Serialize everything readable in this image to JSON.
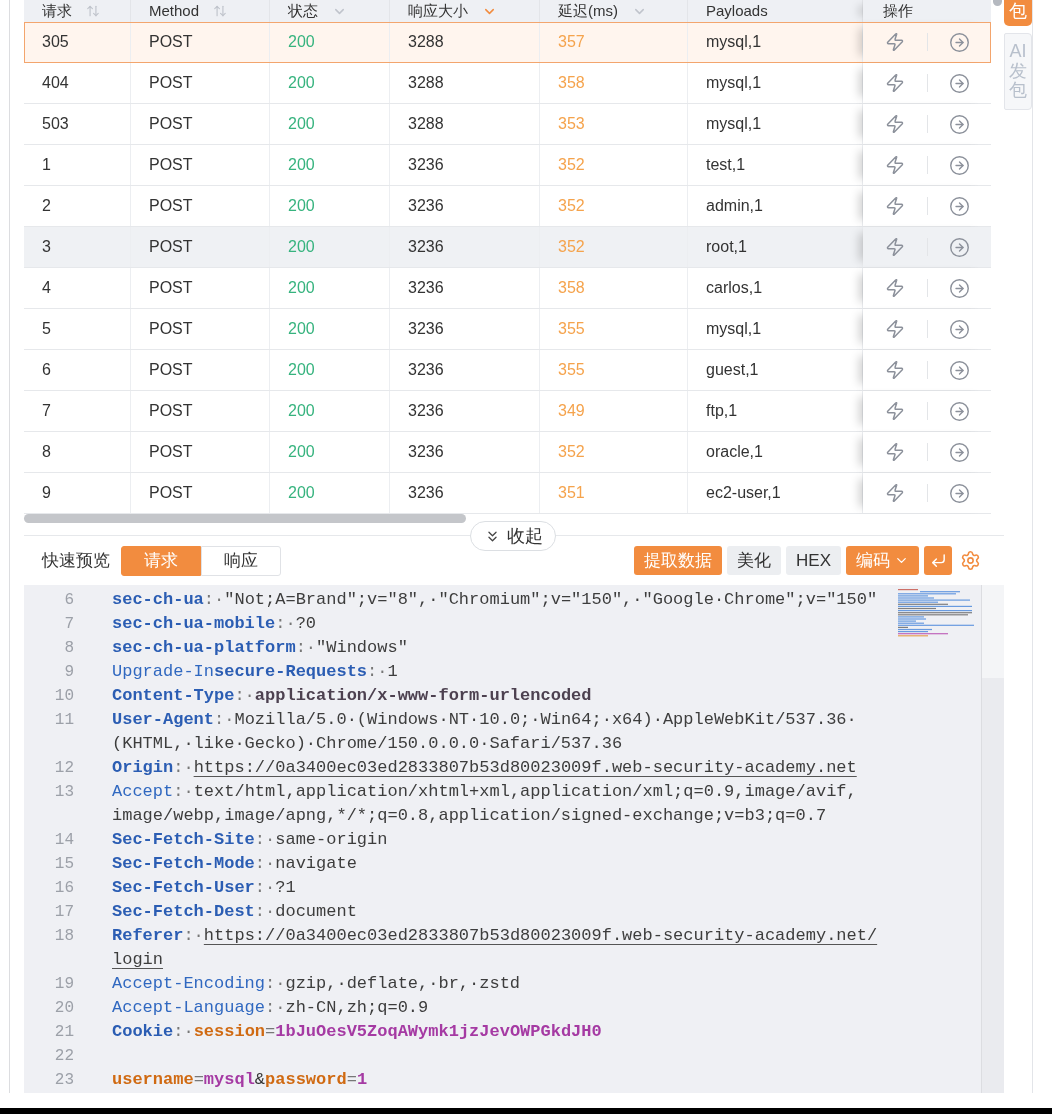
{
  "table": {
    "columns": [
      {
        "label": "请求",
        "kind": "sort",
        "active": false
      },
      {
        "label": "Method",
        "kind": "sort",
        "active": false
      },
      {
        "label": "状态",
        "kind": "filter",
        "active": false
      },
      {
        "label": "响应大小",
        "kind": "filter",
        "active": true
      },
      {
        "label": "延迟(ms)",
        "kind": "filter",
        "active": false
      },
      {
        "label": "Payloads",
        "kind": "plain"
      },
      {
        "label": "操作",
        "kind": "plain"
      }
    ],
    "rows": [
      {
        "request": "305",
        "method": "POST",
        "status": "200",
        "size": "3288",
        "latency": "357",
        "payload": "mysql,1",
        "selected": true,
        "hovered": false
      },
      {
        "request": "404",
        "method": "POST",
        "status": "200",
        "size": "3288",
        "latency": "358",
        "payload": "mysql,1",
        "selected": false,
        "hovered": false
      },
      {
        "request": "503",
        "method": "POST",
        "status": "200",
        "size": "3288",
        "latency": "353",
        "payload": "mysql,1",
        "selected": false,
        "hovered": false
      },
      {
        "request": "1",
        "method": "POST",
        "status": "200",
        "size": "3236",
        "latency": "352",
        "payload": "test,1",
        "selected": false,
        "hovered": false
      },
      {
        "request": "2",
        "method": "POST",
        "status": "200",
        "size": "3236",
        "latency": "352",
        "payload": "admin,1",
        "selected": false,
        "hovered": false
      },
      {
        "request": "3",
        "method": "POST",
        "status": "200",
        "size": "3236",
        "latency": "352",
        "payload": "root,1",
        "selected": false,
        "hovered": true
      },
      {
        "request": "4",
        "method": "POST",
        "status": "200",
        "size": "3236",
        "latency": "358",
        "payload": "carlos,1",
        "selected": false,
        "hovered": false
      },
      {
        "request": "5",
        "method": "POST",
        "status": "200",
        "size": "3236",
        "latency": "355",
        "payload": "mysql,1",
        "selected": false,
        "hovered": false
      },
      {
        "request": "6",
        "method": "POST",
        "status": "200",
        "size": "3236",
        "latency": "355",
        "payload": "guest,1",
        "selected": false,
        "hovered": false
      },
      {
        "request": "7",
        "method": "POST",
        "status": "200",
        "size": "3236",
        "latency": "349",
        "payload": "ftp,1",
        "selected": false,
        "hovered": false
      },
      {
        "request": "8",
        "method": "POST",
        "status": "200",
        "size": "3236",
        "latency": "352",
        "payload": "oracle,1",
        "selected": false,
        "hovered": false
      },
      {
        "request": "9",
        "method": "POST",
        "status": "200",
        "size": "3236",
        "latency": "351",
        "payload": "ec2-user,1",
        "selected": false,
        "hovered": false
      }
    ]
  },
  "collapse_button": {
    "label": "收起"
  },
  "preview": {
    "label": "快速预览",
    "tabs": [
      {
        "label": "请求",
        "selected": true
      },
      {
        "label": "响应",
        "selected": false
      }
    ]
  },
  "toolbar": {
    "buttons": [
      {
        "label": "提取数据",
        "kind": "primary"
      },
      {
        "label": "美化",
        "kind": "plain"
      },
      {
        "label": "HEX",
        "kind": "plain"
      },
      {
        "label": "编码",
        "kind": "menu"
      }
    ]
  },
  "editor": {
    "lines": [
      {
        "number": "6",
        "segments": [
          {
            "kind": "name-bold",
            "text": "sec-ch-ua"
          },
          {
            "kind": "sep",
            "text": ":·"
          },
          {
            "kind": "text",
            "text": "\"Not;A=Brand\";v=\"8\",·\"Chromium\";v=\"150\",·\"Google·Chrome\";v=\"150\""
          }
        ]
      },
      {
        "number": "7",
        "segments": [
          {
            "kind": "name-bold",
            "text": "sec-ch-ua-mobile"
          },
          {
            "kind": "sep",
            "text": ":·"
          },
          {
            "kind": "text",
            "text": "?0"
          }
        ]
      },
      {
        "number": "8",
        "segments": [
          {
            "kind": "name-bold",
            "text": "sec-ch-ua-platform"
          },
          {
            "kind": "sep",
            "text": ":·"
          },
          {
            "kind": "text",
            "text": "\"Windows\""
          }
        ]
      },
      {
        "number": "9",
        "segments": [
          {
            "kind": "name",
            "text": "Upgrade-In"
          },
          {
            "kind": "name-bold",
            "text": "secure-Requests"
          },
          {
            "kind": "sep",
            "text": ":·"
          },
          {
            "kind": "text",
            "text": "1"
          }
        ]
      },
      {
        "number": "10",
        "segments": [
          {
            "kind": "name-bold",
            "text": "Content-Type"
          },
          {
            "kind": "sep",
            "text": ":·"
          },
          {
            "kind": "text-bold",
            "text": "application/x-www-form-urlencoded"
          }
        ]
      },
      {
        "number": "11",
        "segments": [
          {
            "kind": "name-bold",
            "text": "User-Agent"
          },
          {
            "kind": "sep",
            "text": ":·"
          },
          {
            "kind": "text",
            "text": "Mozilla/5.0·(Windows·NT·10.0;·Win64;·x64)·AppleWebKit/537.36·"
          }
        ],
        "continuation": [
          {
            "kind": "text",
            "text": "(KHTML,·like·Gecko)·Chrome/150.0.0.0·Safari/537.36"
          }
        ]
      },
      {
        "number": "12",
        "segments": [
          {
            "kind": "name-bold",
            "text": "Origin"
          },
          {
            "kind": "sep",
            "text": ":·"
          },
          {
            "kind": "link",
            "text": "https://0a3400ec03ed2833807b53d80023009f.web-security-academy.net"
          }
        ]
      },
      {
        "number": "13",
        "segments": [
          {
            "kind": "name",
            "text": "Accept"
          },
          {
            "kind": "sep",
            "text": ":·"
          },
          {
            "kind": "text",
            "text": "text/html,application/xhtml+xml,application/xml;q=0.9,image/avif,"
          }
        ],
        "continuation": [
          {
            "kind": "text",
            "text": "image/webp,image/apng,*/*;q=0.8,application/signed-exchange;v=b3;q=0.7"
          }
        ]
      },
      {
        "number": "14",
        "segments": [
          {
            "kind": "name-bold",
            "text": "Sec-Fetch-Site"
          },
          {
            "kind": "sep",
            "text": ":·"
          },
          {
            "kind": "text",
            "text": "same-origin"
          }
        ]
      },
      {
        "number": "15",
        "segments": [
          {
            "kind": "name-bold",
            "text": "Sec-Fetch-Mode"
          },
          {
            "kind": "sep",
            "text": ":·"
          },
          {
            "kind": "text",
            "text": "navigate"
          }
        ]
      },
      {
        "number": "16",
        "segments": [
          {
            "kind": "name-bold",
            "text": "Sec-Fetch-User"
          },
          {
            "kind": "sep",
            "text": ":·"
          },
          {
            "kind": "text",
            "text": "?1"
          }
        ]
      },
      {
        "number": "17",
        "segments": [
          {
            "kind": "name-bold",
            "text": "Sec-Fetch-Dest"
          },
          {
            "kind": "sep",
            "text": ":·"
          },
          {
            "kind": "text",
            "text": "document"
          }
        ]
      },
      {
        "number": "18",
        "segments": [
          {
            "kind": "name-bold",
            "text": "Referer"
          },
          {
            "kind": "sep",
            "text": ":·"
          },
          {
            "kind": "link",
            "text": "https://0a3400ec03ed2833807b53d80023009f.web-security-academy.net/"
          }
        ],
        "continuation": [
          {
            "kind": "link",
            "text": "login"
          }
        ]
      },
      {
        "number": "19",
        "segments": [
          {
            "kind": "name",
            "text": "Accept-Encoding"
          },
          {
            "kind": "sep",
            "text": ":·"
          },
          {
            "kind": "text",
            "text": "gzip,·deflate,·br,·zstd"
          }
        ]
      },
      {
        "number": "20",
        "segments": [
          {
            "kind": "name",
            "text": "Accept-Language"
          },
          {
            "kind": "sep",
            "text": ":·"
          },
          {
            "kind": "text",
            "text": "zh-CN,zh;q=0.9"
          }
        ]
      },
      {
        "number": "21",
        "segments": [
          {
            "kind": "name-bold",
            "text": "Cookie"
          },
          {
            "kind": "sep",
            "text": ":·"
          },
          {
            "kind": "param",
            "text": "session"
          },
          {
            "kind": "sep",
            "text": "="
          },
          {
            "kind": "value",
            "text": "1bJuOesV5ZoqAWymk1jzJevOWPGkdJH0"
          }
        ]
      },
      {
        "number": "22"
      },
      {
        "number": "23",
        "segments": [
          {
            "kind": "param",
            "text": "username"
          },
          {
            "kind": "sep",
            "text": "="
          },
          {
            "kind": "value",
            "text": "mysql"
          },
          {
            "kind": "amp",
            "text": "&"
          },
          {
            "kind": "param",
            "text": "password"
          },
          {
            "kind": "sep",
            "text": "="
          },
          {
            "kind": "value",
            "text": "1"
          }
        ]
      }
    ]
  },
  "side_tabs": [
    {
      "label": "包",
      "selected": true
    },
    {
      "label": "AI发包",
      "selected": false
    }
  ]
}
